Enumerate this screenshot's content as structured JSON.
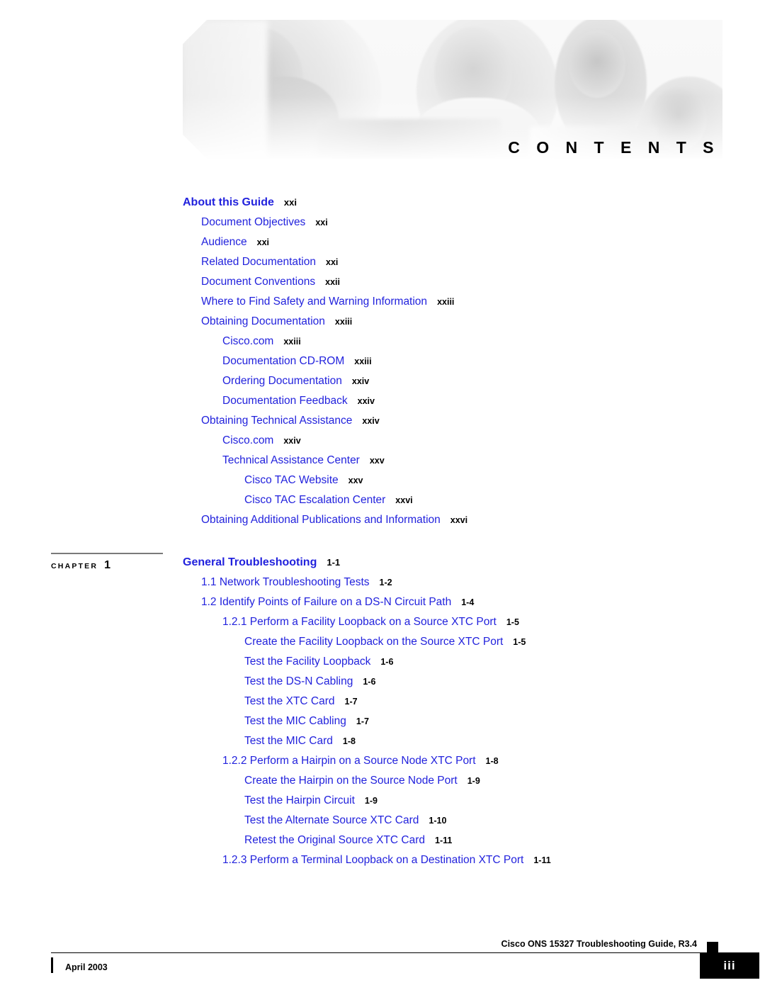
{
  "banner": {
    "title": "C O N T E N T S",
    "image_name": "cisco-people-laptops-banner"
  },
  "toc": {
    "entries": [
      {
        "label": "About this Guide",
        "page": "xxi",
        "level": 0,
        "style": "head"
      },
      {
        "label": "Document Objectives",
        "page": "xxi",
        "level": 1,
        "style": "normal"
      },
      {
        "label": "Audience",
        "page": "xxi",
        "level": 1,
        "style": "normal"
      },
      {
        "label": "Related Documentation",
        "page": "xxi",
        "level": 1,
        "style": "normal"
      },
      {
        "label": "Document Conventions",
        "page": "xxii",
        "level": 1,
        "style": "normal"
      },
      {
        "label": "Where to Find Safety and Warning Information",
        "page": "xxiii",
        "level": 1,
        "style": "normal"
      },
      {
        "label": "Obtaining Documentation",
        "page": "xxiii",
        "level": 1,
        "style": "normal"
      },
      {
        "label": "Cisco.com",
        "page": "xxiii",
        "level": 2,
        "style": "normal"
      },
      {
        "label": "Documentation CD-ROM",
        "page": "xxiii",
        "level": 2,
        "style": "normal"
      },
      {
        "label": "Ordering Documentation",
        "page": "xxiv",
        "level": 2,
        "style": "normal"
      },
      {
        "label": "Documentation Feedback",
        "page": "xxiv",
        "level": 2,
        "style": "normal"
      },
      {
        "label": "Obtaining Technical Assistance",
        "page": "xxiv",
        "level": 1,
        "style": "normal"
      },
      {
        "label": "Cisco.com",
        "page": "xxiv",
        "level": 2,
        "style": "normal"
      },
      {
        "label": "Technical Assistance Center",
        "page": "xxv",
        "level": 2,
        "style": "normal"
      },
      {
        "label": "Cisco TAC Website",
        "page": "xxv",
        "level": 3,
        "style": "normal"
      },
      {
        "label": "Cisco TAC Escalation Center",
        "page": "xxvi",
        "level": 3,
        "style": "normal"
      },
      {
        "label": "Obtaining Additional Publications and Information",
        "page": "xxvi",
        "level": 1,
        "style": "normal"
      }
    ]
  },
  "chapter": {
    "marker_word": "CHAPTER",
    "marker_number": "1",
    "entries": [
      {
        "label": "General Troubleshooting",
        "page": "1-1",
        "level": 0,
        "style": "head"
      },
      {
        "label": "1.1  Network Troubleshooting Tests",
        "page": "1-2",
        "level": 1,
        "style": "normal"
      },
      {
        "label": "1.2  Identify Points of Failure on a DS-N Circuit Path",
        "page": "1-4",
        "level": 1,
        "style": "normal"
      },
      {
        "label": "1.2.1  Perform a Facility Loopback on a Source XTC Port",
        "page": "1-5",
        "level": 2,
        "style": "normal"
      },
      {
        "label": "Create the Facility Loopback on the Source XTC Port",
        "page": "1-5",
        "level": 3,
        "style": "normal"
      },
      {
        "label": "Test the Facility Loopback",
        "page": "1-6",
        "level": 3,
        "style": "normal"
      },
      {
        "label": "Test the DS-N Cabling",
        "page": "1-6",
        "level": 3,
        "style": "normal"
      },
      {
        "label": "Test the XTC Card",
        "page": "1-7",
        "level": 3,
        "style": "normal"
      },
      {
        "label": "Test the MIC Cabling",
        "page": "1-7",
        "level": 3,
        "style": "normal"
      },
      {
        "label": "Test the MIC Card",
        "page": "1-8",
        "level": 3,
        "style": "normal"
      },
      {
        "label": "1.2.2  Perform a Hairpin on a Source Node XTC Port",
        "page": "1-8",
        "level": 2,
        "style": "normal"
      },
      {
        "label": "Create the Hairpin on the Source Node Port",
        "page": "1-9",
        "level": 3,
        "style": "normal"
      },
      {
        "label": "Test the Hairpin Circuit",
        "page": "1-9",
        "level": 3,
        "style": "normal"
      },
      {
        "label": "Test the Alternate Source XTC Card",
        "page": "1-10",
        "level": 3,
        "style": "normal"
      },
      {
        "label": "Retest the Original Source XTC Card",
        "page": "1-11",
        "level": 3,
        "style": "normal"
      },
      {
        "label": "1.2.3  Perform a Terminal Loopback on a Destination XTC Port",
        "page": "1-11",
        "level": 2,
        "style": "normal"
      }
    ]
  },
  "footer": {
    "guide_title": "Cisco ONS 15327 Troubleshooting Guide, R3.4",
    "date": "April 2003",
    "page_number": "iii"
  },
  "colors": {
    "link_blue": "#2222dd",
    "text_black": "#000000",
    "rule_gray": "#7a7a7a"
  }
}
